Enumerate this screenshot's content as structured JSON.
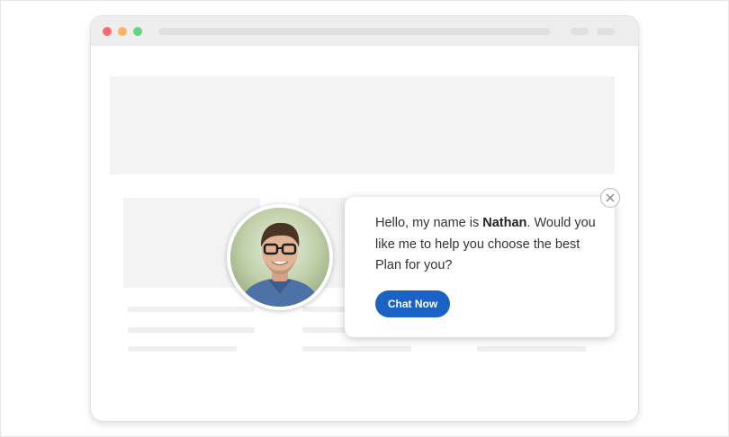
{
  "chat_widget": {
    "greeting_prefix": "Hello, my name is ",
    "agent_name": "Nathan",
    "greeting_suffix": ". Would you like me to help you choose the best Plan for you?",
    "chat_button_label": "Chat Now"
  },
  "colors": {
    "accent": "#1a63c5",
    "window_dot_red": "#ff6b6b",
    "window_dot_yellow": "#ffb35a",
    "window_dot_green": "#5ed97a"
  },
  "icons": {
    "close": "close-icon",
    "avatar": "agent-avatar"
  }
}
